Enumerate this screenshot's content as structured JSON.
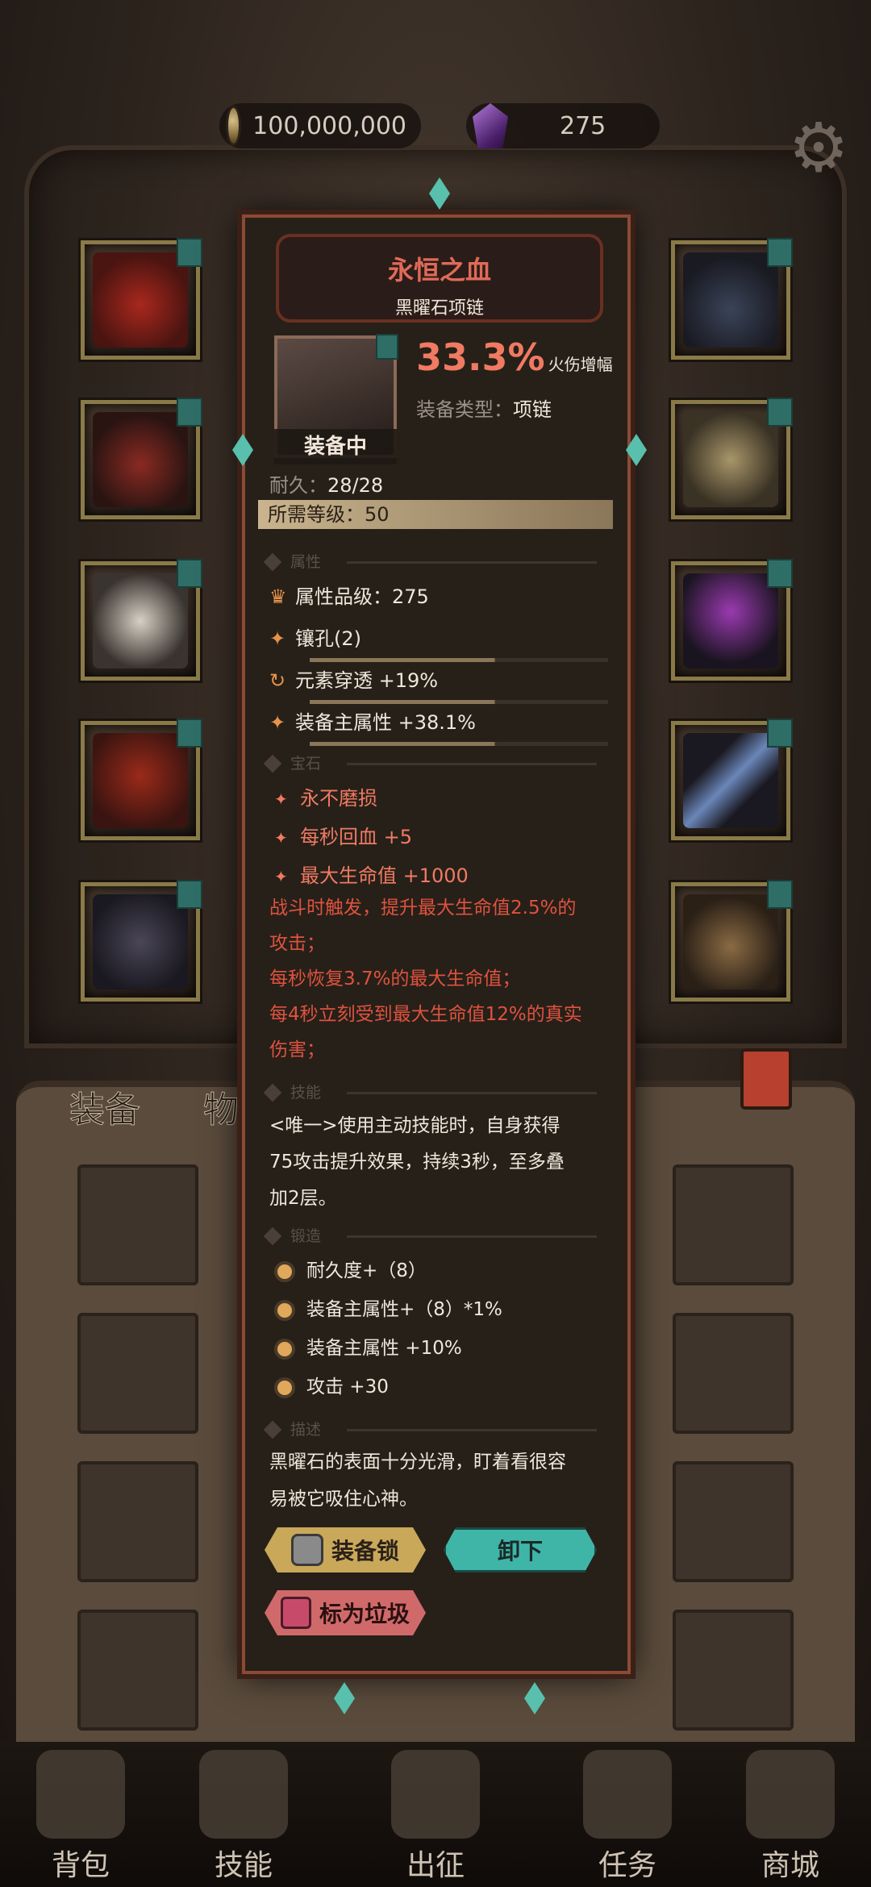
{
  "currency": {
    "gold": "100,000,000",
    "gems": "275"
  },
  "equipment_slots": {
    "left": [
      "red-cape",
      "red-robe",
      "white-gauntlet",
      "red-pants",
      "dark-boots"
    ],
    "right": [
      "obsidian-necklace",
      "stone-ring",
      "purple-helmet",
      "ice-sword",
      "leather-satchel"
    ]
  },
  "side_tabs": {
    "equipment": "装备",
    "items": "物品"
  },
  "item": {
    "name": "永恒之血",
    "subtitle": "黑曜石项链",
    "status": "装备中",
    "main_stat_value": "33.3%",
    "main_stat_label": "火伤增幅",
    "type_label": "装备类型：",
    "type_value": "项链",
    "durability_label": "耐久：",
    "durability_value": "28/28",
    "required_level_label": "所需等级：",
    "required_level": "50"
  },
  "sections": {
    "attributes": "属性",
    "gems": "宝石",
    "skills": "技能",
    "forge": "锻造",
    "description": "描述"
  },
  "attributes": [
    {
      "icon": "crown-icon",
      "text": "属性品级：275"
    },
    {
      "icon": "spark-icon",
      "text": "镶孔(2)"
    },
    {
      "icon": "swirl-icon",
      "text": "元素穿透 +19%"
    },
    {
      "icon": "spark-icon",
      "text": "装备主属性 +38.1%"
    }
  ],
  "gems": [
    "永不磨损",
    "每秒回血 +5",
    "最大生命值 +1000"
  ],
  "effects": [
    "战斗时触发，提升最大生命值2.5%的",
    "攻击；",
    "每秒恢复3.7%的最大生命值；",
    "每4秒立刻受到最大生命值12%的真实",
    "伤害；"
  ],
  "skill_lines": [
    "<唯一>使用主动技能时，自身获得",
    "75攻击提升效果，持续3秒，至多叠",
    "加2层。"
  ],
  "forge": [
    "耐久度+（8）",
    "装备主属性+（8）*1%",
    "装备主属性 +10%",
    "攻击 +30"
  ],
  "description_lines": [
    "黑曜石的表面十分光滑，盯着看很容",
    "易被它吸住心神。"
  ],
  "buttons": {
    "lock": "装备锁",
    "unequip": "卸下",
    "junk": "标为垃圾"
  },
  "nav": [
    "背包",
    "技能",
    "出征",
    "任务",
    "商城"
  ],
  "colors": {
    "accent_red": "#f07a62",
    "teal": "#3fb5a8",
    "gold": "#c9a85a"
  }
}
